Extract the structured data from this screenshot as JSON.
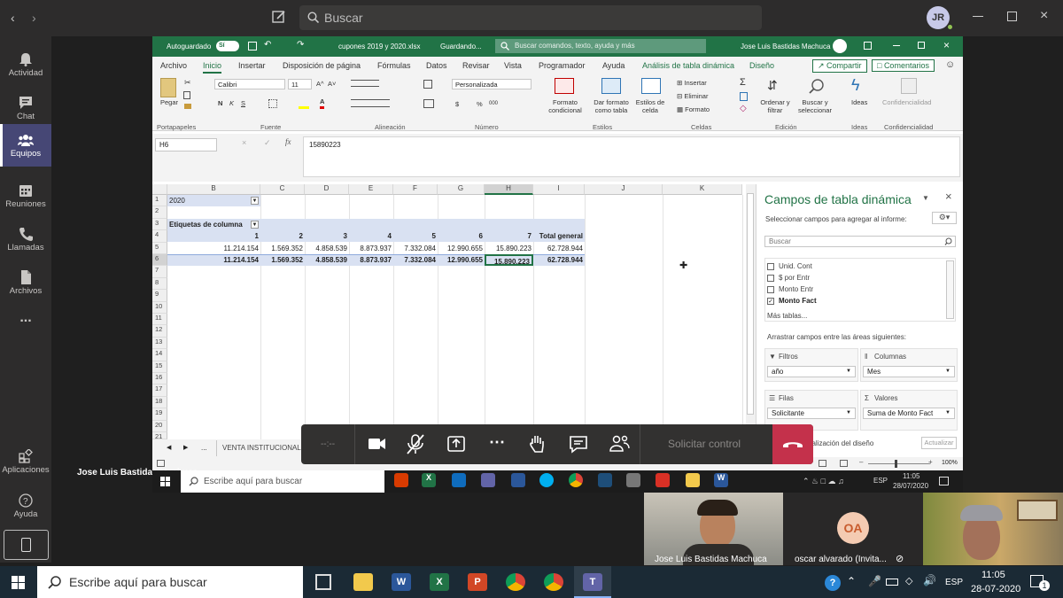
{
  "teams": {
    "search_placeholder": "Buscar",
    "avatar_initials": "JR",
    "rail": [
      {
        "label": "Actividad",
        "icon": "bell-icon"
      },
      {
        "label": "Chat",
        "icon": "chat-icon"
      },
      {
        "label": "Equipos",
        "icon": "teams-icon"
      },
      {
        "label": "Reuniones",
        "icon": "calendar-icon"
      },
      {
        "label": "Llamadas",
        "icon": "phone-icon"
      },
      {
        "label": "Archivos",
        "icon": "file-icon"
      }
    ],
    "rail_more": "...",
    "rail_bottom": [
      {
        "label": "Aplicaciones",
        "icon": "apps-icon"
      },
      {
        "label": "Ayuda",
        "icon": "help-icon"
      }
    ],
    "presenter_label": "Jose Luis Bastidas Machuca"
  },
  "excel": {
    "autosave_label": "Autoguardado",
    "autosave_state": "Sí",
    "filename": "cupones 2019 y 2020.xlsx",
    "save_status": "Guardando...",
    "command_search": "Buscar comandos, texto, ayuda y más",
    "user": "Jose Luis Bastidas Machuca",
    "tabs": [
      "Archivo",
      "Inicio",
      "Insertar",
      "Disposición de página",
      "Fórmulas",
      "Datos",
      "Revisar",
      "Vista",
      "Programador",
      "Ayuda",
      "Análisis de tabla dinámica",
      "Diseño"
    ],
    "share": "Compartir",
    "comments": "Comentarios",
    "ribbon": {
      "paste": "Pegar",
      "font_name": "Calibri",
      "font_size": "11",
      "bold": "N",
      "italic": "K",
      "underline": "S",
      "grow_font": "A^",
      "shrink_font": "A˅",
      "number_format": "Personalizada",
      "currency": "$",
      "percent": "%",
      "thousands": "000",
      "cond_format": "Formato condicional",
      "format_table": "Dar formato como tabla",
      "cell_styles": "Estilos de celda",
      "insert": "Insertar",
      "delete": "Eliminar",
      "format": "Formato",
      "sort_filter": "Ordenar y filtrar",
      "find_select": "Buscar y seleccionar",
      "ideas": "Ideas",
      "confidentiality": "Confidencialidad",
      "groups": [
        "Portapapeles",
        "Fuente",
        "Alineación",
        "Número",
        "Estilos",
        "Celdas",
        "Edición",
        "Ideas",
        "Confidencialidad"
      ]
    },
    "namebox": "H6",
    "formula": "15890223",
    "columns": [
      "B",
      "C",
      "D",
      "E",
      "F",
      "G",
      "H",
      "I",
      "J",
      "K"
    ],
    "rows": [
      "1",
      "2",
      "3",
      "4",
      "5",
      "6",
      "7",
      "8",
      "9",
      "10",
      "11",
      "12",
      "13",
      "14",
      "15",
      "16",
      "17",
      "18",
      "19",
      "20",
      "21"
    ],
    "pivot": {
      "filter_value": "2020",
      "col_labels": "Etiquetas de columna",
      "headers": [
        "1",
        "2",
        "3",
        "4",
        "5",
        "6",
        "7",
        "Total general"
      ],
      "row5": [
        "11.214.154",
        "1.569.352",
        "4.858.539",
        "8.873.937",
        "7.332.084",
        "12.990.655",
        "15.890.223",
        "62.728.944"
      ],
      "row6": [
        "11.214.154",
        "1.569.352",
        "4.858.539",
        "8.873.937",
        "7.332.084",
        "12.990.655",
        "15.890.223",
        "62.728.944"
      ]
    },
    "sheet_tab": "VENTA INSTITUCIONAL",
    "sheet_nav": "...",
    "zoom": "100%",
    "pane": {
      "title": "Campos de tabla dinámica",
      "subtitle": "Seleccionar campos para agregar al informe:",
      "search_placeholder": "Buscar",
      "fields": [
        {
          "label": "Unid. Cont",
          "checked": false
        },
        {
          "label": "$ por Entr",
          "checked": false
        },
        {
          "label": "Monto Entr",
          "checked": false
        },
        {
          "label": "Monto Fact",
          "checked": true
        }
      ],
      "more_tables": "Más tablas...",
      "drag_hint": "Arrastrar campos entre las áreas siguientes:",
      "filters_label": "Filtros",
      "filters_value": "año",
      "columns_label": "Columnas",
      "columns_value": "Mes",
      "rows_label": "Filas",
      "rows_value": "Solicitante",
      "values_label": "Valores",
      "values_value": "Suma de Monto Fact",
      "defer_label": "ualización del diseño",
      "update_button": "Actualizar"
    }
  },
  "call": {
    "timer": "--:--",
    "request_control": "Solicitar control"
  },
  "remote_taskbar": {
    "search": "Escribe aquí para buscar",
    "lang": "ESP",
    "time": "11:05",
    "date": "28/07/2020"
  },
  "participants": [
    {
      "name": "Jose Luis Bastidas Machuca"
    },
    {
      "name": "oscar alvarado (Invita...",
      "initials": "OA"
    }
  ],
  "taskbar": {
    "search": "Escribe aquí para buscar",
    "lang": "ESP",
    "time": "11:05",
    "date": "28-07-2020",
    "notifications": "1"
  }
}
